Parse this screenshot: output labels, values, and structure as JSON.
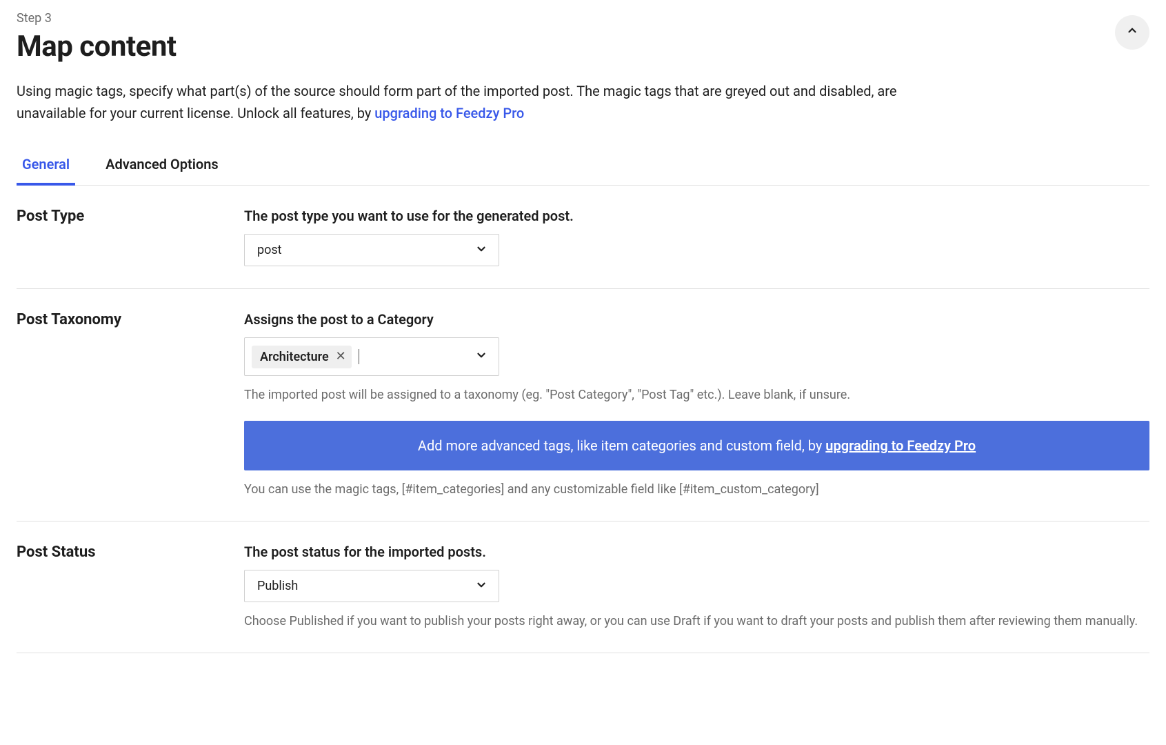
{
  "header": {
    "step": "Step 3",
    "title": "Map content"
  },
  "intro": {
    "textBefore": "Using magic tags, specify what part(s) of the source should form part of the imported post. The magic tags that are greyed out and disabled, are unavailable for your current license. Unlock all features, by ",
    "linkText": "upgrading to Feedzy Pro"
  },
  "tabs": {
    "general": "General",
    "advanced": "Advanced Options"
  },
  "sections": {
    "postType": {
      "title": "Post Type",
      "label": "The post type you want to use for the generated post.",
      "value": "post"
    },
    "postTaxonomy": {
      "title": "Post Taxonomy",
      "label": "Assigns the post to a Category",
      "tag": "Architecture",
      "help1": "The imported post will be assigned to a taxonomy (eg. \"Post Category\", \"Post Tag\" etc.). Leave blank, if unsure.",
      "bannerBefore": "Add more advanced tags, like item categories and custom field, by ",
      "bannerLink": "upgrading to Feedzy Pro",
      "help2": "You can use the magic tags, [#item_categories] and any customizable field like [#item_custom_category]"
    },
    "postStatus": {
      "title": "Post Status",
      "label": "The post status for the imported posts.",
      "value": "Publish",
      "help": "Choose Published if you want to publish your posts right away, or you can use Draft if you want to draft your posts and publish them after reviewing them manually."
    }
  }
}
